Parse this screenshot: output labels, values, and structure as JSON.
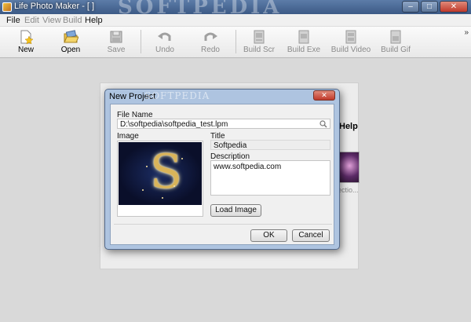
{
  "window": {
    "title": "Life Photo Maker - [ ]",
    "watermark": "SOFTPEDIA",
    "controls": {
      "minimize": "–",
      "maximize": "□",
      "close": "✕"
    }
  },
  "menu": [
    "File",
    "Edit",
    "View",
    "Build",
    "Help"
  ],
  "toolbar": {
    "new": "New",
    "open": "Open",
    "save": "Save",
    "undo": "Undo",
    "redo": "Redo",
    "build_scr": "Build Scr",
    "build_exe": "Build Exe",
    "build_video": "Build Video",
    "build_gif": "Build Gif",
    "overflow": "»"
  },
  "background": {
    "help_link": "Help",
    "thumb_caption": "ectio..."
  },
  "dialog": {
    "title": "New Project",
    "watermark": "SOFTPEDIA",
    "close": "✕",
    "file_name_label": "File Name",
    "file_name_value": "D:\\softpedia\\softpedia_test.lpm",
    "image_label": "Image",
    "title_label": "Title",
    "title_value": "Softpedia",
    "description_label": "Description",
    "description_value": "www.softpedia.com",
    "load_image": "Load Image",
    "ok": "OK",
    "cancel": "Cancel"
  }
}
